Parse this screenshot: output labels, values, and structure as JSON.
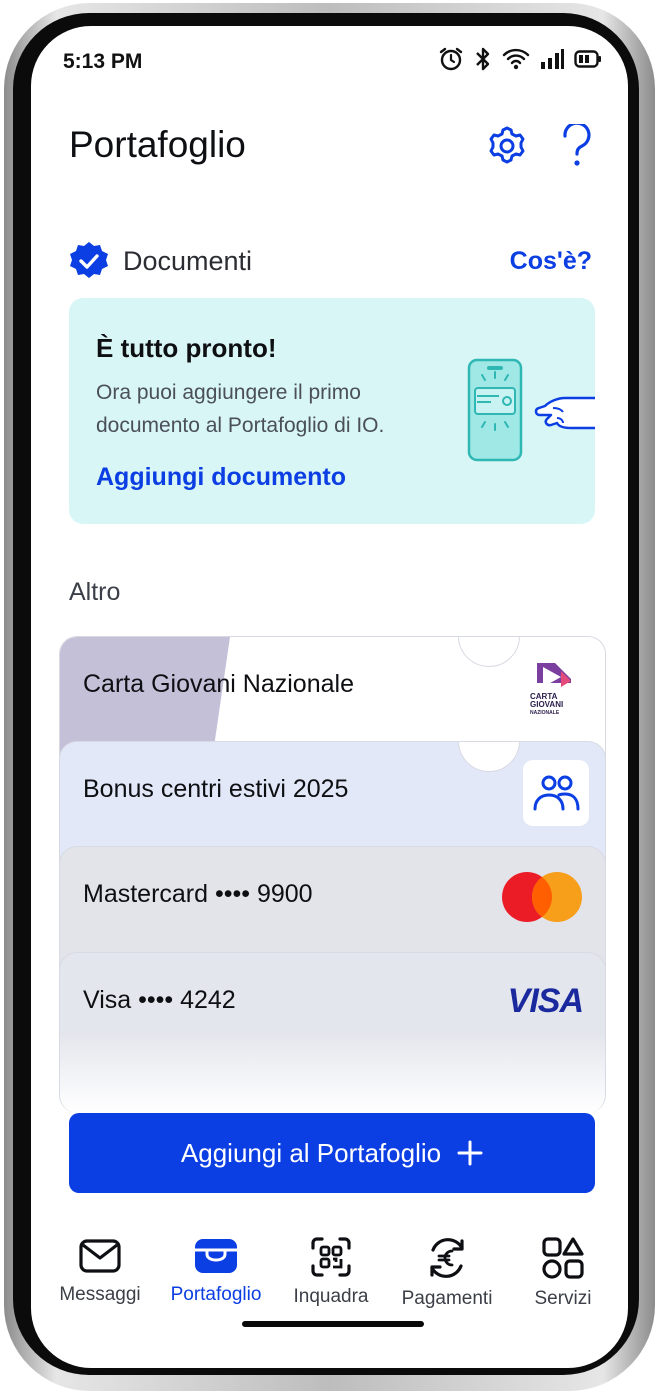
{
  "status_bar": {
    "time": "5:13 PM",
    "icons": [
      "alarm-icon",
      "bluetooth-icon",
      "wifi-icon",
      "signal-icon",
      "battery-icon"
    ]
  },
  "header": {
    "title": "Portafoglio",
    "settings_icon": "gear-icon",
    "help_icon": "question-icon"
  },
  "documents": {
    "section_label": "Documenti",
    "info_link": "Cos'è?",
    "empty_state": {
      "title": "È tutto pronto!",
      "description": "Ora puoi aggiungere il primo documento al Portafoglio di IO.",
      "cta": "Aggiungi documento"
    }
  },
  "other": {
    "section_label": "Altro",
    "cards": [
      {
        "label": "Carta Giovani Nazionale",
        "logo_text": [
          "CARTA",
          "GIOVANI",
          "NAZIONALE"
        ]
      },
      {
        "label": "Bonus centri estivi 2025",
        "icon": "people-icon"
      },
      {
        "label": "Mastercard •••• 9900",
        "brand": "mastercard"
      },
      {
        "label": "Visa •••• 4242",
        "brand_text": "VISA"
      }
    ]
  },
  "add_button": {
    "label": "Aggiungi al Portafoglio",
    "icon": "plus-icon"
  },
  "tabbar": {
    "tabs": [
      {
        "label": "Messaggi",
        "icon": "mail-icon"
      },
      {
        "label": "Portafoglio",
        "icon": "wallet-icon",
        "active": true
      },
      {
        "label": "Inquadra",
        "icon": "qr-scan-icon"
      },
      {
        "label": "Pagamenti",
        "icon": "euro-exchange-icon"
      },
      {
        "label": "Servizi",
        "icon": "services-grid-icon"
      }
    ]
  },
  "colors": {
    "accent": "#0b3ee3",
    "empty_card_bg": "#d9f6f6",
    "bonus_card_bg": "#e3e8f8",
    "cgn_tint": "#c4c0d7"
  }
}
